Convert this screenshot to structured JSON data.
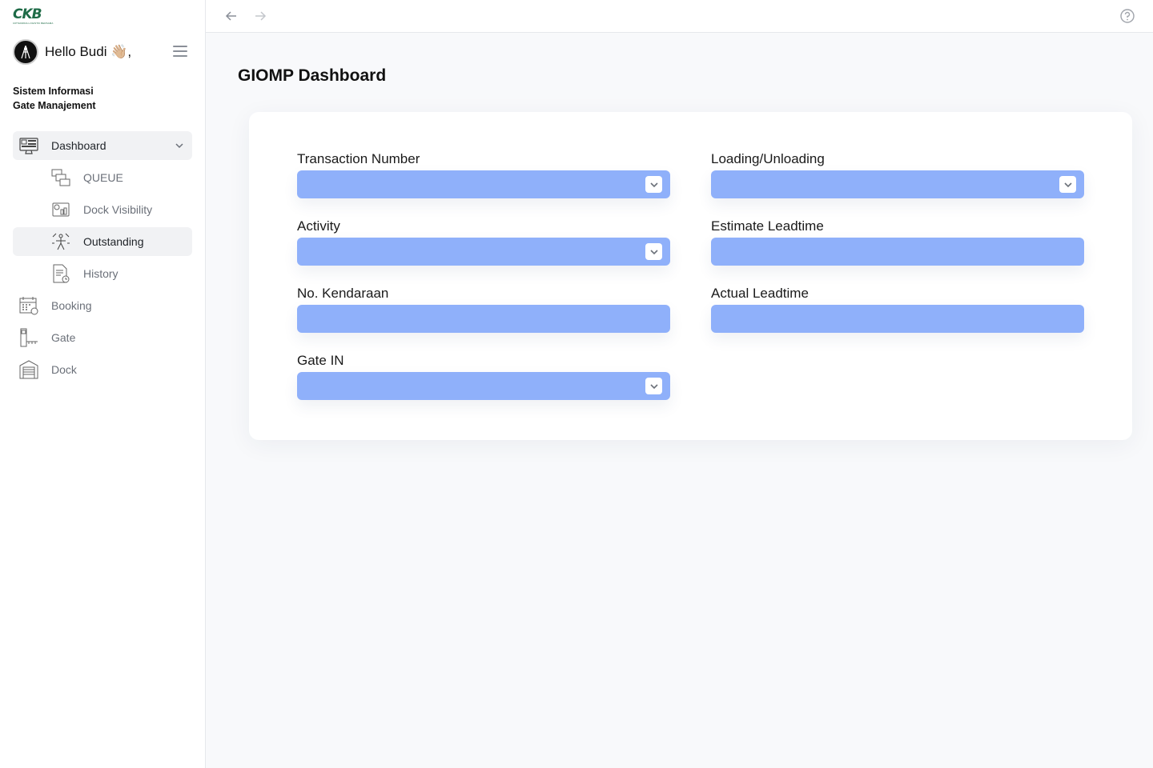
{
  "brand": {
    "logo_text": "CKB",
    "logo_tagline": "CIPTAKRIDA LOGISTIK BERSAMA"
  },
  "user": {
    "greeting": "Hello Budi 👋🏼,"
  },
  "app": {
    "name_line1": "Sistem Informasi",
    "name_line2": "Gate Manajement"
  },
  "sidebar": {
    "items": [
      {
        "label": "Dashboard",
        "icon": "dashboard-icon",
        "active": true,
        "expanded": true
      },
      {
        "label": "QUEUE",
        "icon": "queue-icon",
        "sub": true
      },
      {
        "label": "Dock Visibility",
        "icon": "dock-visibility-icon",
        "sub": true
      },
      {
        "label": "Outstanding",
        "icon": "outstanding-icon",
        "sub": true,
        "active": true
      },
      {
        "label": "History",
        "icon": "history-icon",
        "sub": true
      },
      {
        "label": "Booking",
        "icon": "booking-icon"
      },
      {
        "label": "Gate",
        "icon": "gate-icon"
      },
      {
        "label": "Dock",
        "icon": "dock-icon"
      }
    ]
  },
  "main": {
    "title": "GIOMP Dashboard"
  },
  "form": {
    "transaction_number": {
      "label": "Transaction Number",
      "value": ""
    },
    "activity": {
      "label": "Activity",
      "value": ""
    },
    "no_kendaraan": {
      "label": "No. Kendaraan",
      "value": ""
    },
    "gate_in": {
      "label": "Gate IN",
      "value": ""
    },
    "loading_unloading": {
      "label": "Loading/Unloading",
      "value": ""
    },
    "estimate_leadtime": {
      "label": "Estimate Leadtime",
      "value": ""
    },
    "actual_leadtime": {
      "label": "Actual Leadtime",
      "value": ""
    }
  },
  "colors": {
    "accent": "#8fb0fa",
    "brand": "#1e6b47",
    "nav_active_bg": "#f1f2f4"
  }
}
